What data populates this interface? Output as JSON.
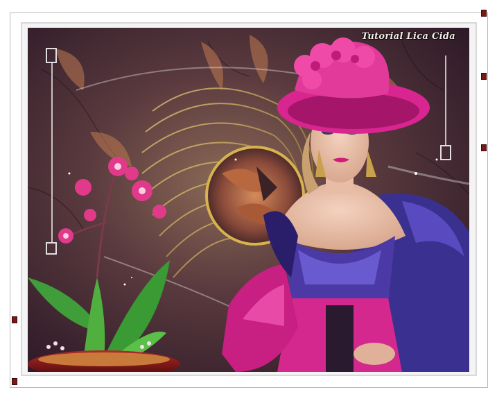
{
  "artwork": {
    "watermark_text": "Tutorial Lica Cida",
    "colors": {
      "background": "#3a2230",
      "hat": "#d9258f",
      "dress_top": "#4b3aa6",
      "dress_pink": "#d4288f",
      "orchid": "#e23a8a",
      "leaves": "#3f9e3a",
      "gold": "#c9a14b"
    }
  }
}
